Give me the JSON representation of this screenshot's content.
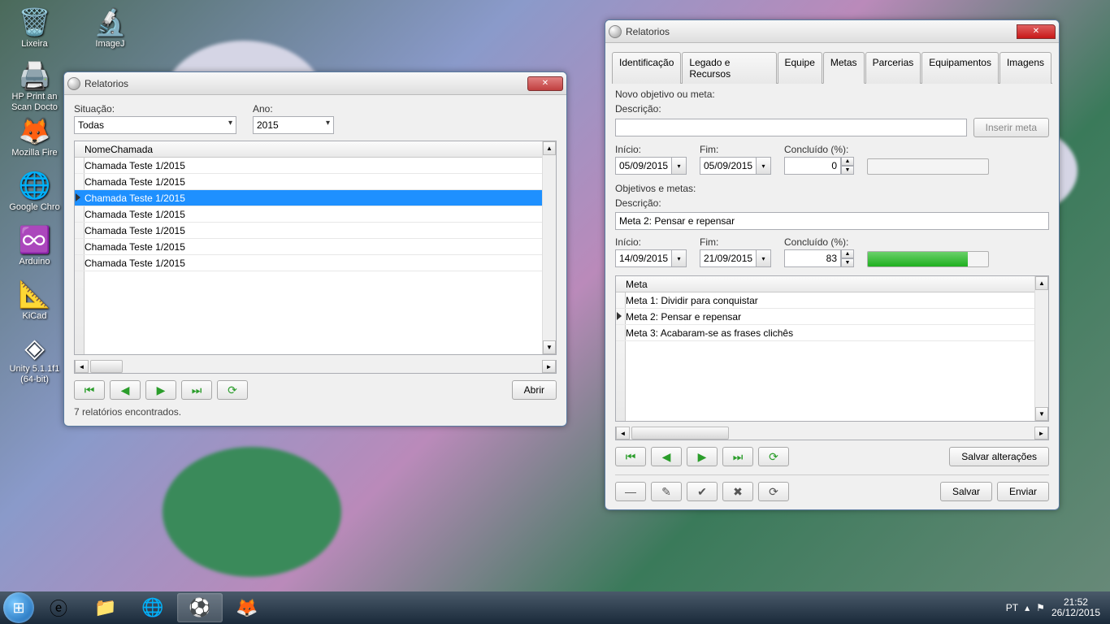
{
  "desktop": {
    "icons": [
      {
        "label": "Lixeira",
        "glyph": "🗑️"
      },
      {
        "label": "ImageJ",
        "glyph": "🔬"
      },
      {
        "label": "HP Print an Scan Docto",
        "glyph": "🖨️"
      },
      {
        "label": "",
        "glyph": ""
      },
      {
        "label": "Mozilla Fire",
        "glyph": "🦊"
      },
      {
        "label": "",
        "glyph": ""
      },
      {
        "label": "Google Chro",
        "glyph": "🌐"
      },
      {
        "label": "",
        "glyph": ""
      },
      {
        "label": "Arduino",
        "glyph": "♾️"
      },
      {
        "label": "",
        "glyph": ""
      },
      {
        "label": "KiCad",
        "glyph": "📐"
      },
      {
        "label": "",
        "glyph": ""
      },
      {
        "label": "Unity 5.1.1f1 (64-bit)",
        "glyph": "◈"
      }
    ]
  },
  "window1": {
    "title": "Relatorios",
    "situacao_label": "Situação:",
    "ano_label": "Ano:",
    "situacao_value": "Todas",
    "ano_value": "2015",
    "col_header": "NomeChamada",
    "rows": [
      "Chamada Teste 1/2015",
      "Chamada Teste 1/2015",
      "Chamada Teste 1/2015",
      "Chamada Teste 1/2015",
      "Chamada Teste 1/2015",
      "Chamada Teste 1/2015",
      "Chamada Teste 1/2015"
    ],
    "selected_index": 2,
    "abrir": "Abrir",
    "status": "7 relatórios encontrados."
  },
  "window2": {
    "title": "Relatorios",
    "tabs": [
      "Identificação",
      "Legado e Recursos",
      "Equipe",
      "Metas",
      "Parcerias",
      "Equipamentos",
      "Imagens"
    ],
    "active_tab": 3,
    "novo_header": "Novo objetivo ou meta:",
    "descricao_label": "Descrição:",
    "descricao_value": "",
    "inserir_meta": "Inserir meta",
    "inicio_label": "Início:",
    "fim_label": "Fim:",
    "concluido_label": "Concluído (%):",
    "novo_inicio": "05/09/2015",
    "novo_fim": "05/09/2015",
    "novo_concluido": "0",
    "novo_progress": 0,
    "obj_header": "Objetivos e metas:",
    "obj_descricao": "Meta 2: Pensar e repensar",
    "obj_inicio": "14/09/2015",
    "obj_fim": "21/09/2015",
    "obj_concluido": "83",
    "obj_progress": 83,
    "metas_col": "Meta",
    "metas": [
      "Meta 1: Dividir para conquistar",
      "Meta 2: Pensar e repensar",
      "Meta 3: Acabaram-se as frases clichês"
    ],
    "meta_selected": 1,
    "salvar_alt": "Salvar alterações",
    "salvar": "Salvar",
    "enviar": "Enviar"
  },
  "taskbar": {
    "lang": "PT",
    "time": "21:52",
    "date": "26/12/2015"
  }
}
